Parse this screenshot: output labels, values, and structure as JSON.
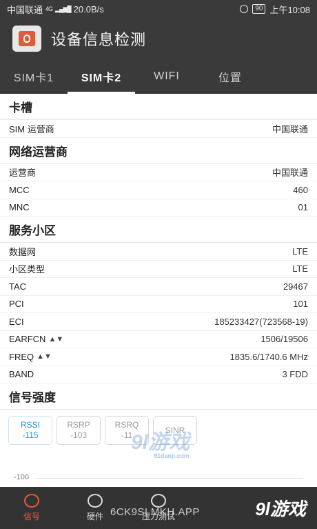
{
  "status_bar": {
    "carrier": "中国联通",
    "network": "4G",
    "speed": "20.0B/s",
    "battery": "90",
    "time": "上午10:08"
  },
  "app": {
    "title": "设备信息检测"
  },
  "tabs": [
    {
      "label": "SIM卡1",
      "active": false
    },
    {
      "label": "SIM卡2",
      "active": true
    },
    {
      "label": "WIFI",
      "active": false
    },
    {
      "label": "位置",
      "active": false
    }
  ],
  "sections": {
    "slot": {
      "title": "卡槽",
      "rows": [
        {
          "label": "SIM 运营商",
          "value": "中国联通"
        }
      ]
    },
    "network": {
      "title": "网络运营商",
      "rows": [
        {
          "label": "运营商",
          "value": "中国联通"
        },
        {
          "label": "MCC",
          "value": "460"
        },
        {
          "label": "MNC",
          "value": "01"
        }
      ]
    },
    "cell": {
      "title": "服务小区",
      "rows": [
        {
          "label": "数据网",
          "value": "LTE"
        },
        {
          "label": "小区类型",
          "value": "LTE"
        },
        {
          "label": "TAC",
          "value": "29467"
        },
        {
          "label": "PCI",
          "value": "101"
        },
        {
          "label": "ECI",
          "value": "185233427(723568-19)"
        },
        {
          "label": "EARFCN",
          "value": "1506/19506",
          "arrows": "▲▼"
        },
        {
          "label": "FREQ",
          "value": "1835.6/1740.6 MHz",
          "arrows": "▲▼"
        },
        {
          "label": "BAND",
          "value": "3 FDD"
        }
      ]
    },
    "signal": {
      "title": "信号强度",
      "chips": [
        {
          "name": "RSSI",
          "value": "-115",
          "active": true
        },
        {
          "name": "RSRP",
          "value": "-103",
          "active": false
        },
        {
          "name": "RSRQ",
          "value": "-11",
          "active": false
        },
        {
          "name": "SINR",
          "value": "",
          "active": false
        }
      ],
      "chart_label": "-100"
    }
  },
  "bottom_nav": [
    {
      "label": "信号",
      "active": true
    },
    {
      "label": "硬件",
      "active": false
    },
    {
      "label": "压力测试",
      "active": false
    }
  ],
  "overlay": {
    "code": "6CK9SLMKH.APP",
    "watermark_main": "9l游戏",
    "watermark_sub": "91danji.com",
    "logo_text": "9l游戏"
  }
}
